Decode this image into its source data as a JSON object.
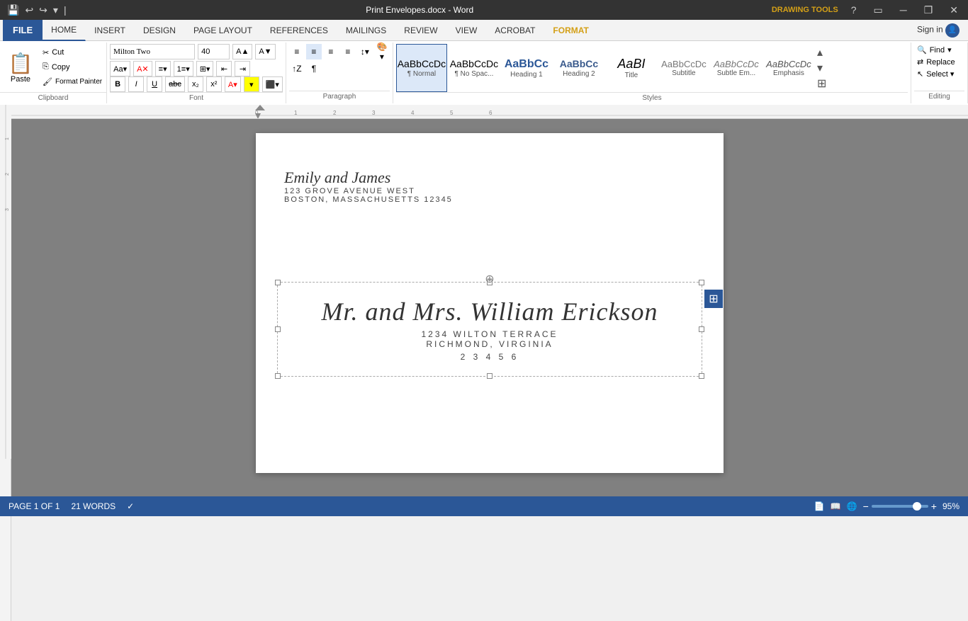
{
  "titleBar": {
    "title": "Print Envelopes.docx - Word",
    "drawingTools": "DRAWING TOOLS",
    "windowButtons": [
      "minimize",
      "restore",
      "close"
    ],
    "helpIcon": "?"
  },
  "tabs": {
    "file": "FILE",
    "home": "HOME",
    "insert": "INSERT",
    "design": "DESIGN",
    "pageLayout": "PAGE LAYOUT",
    "references": "REFERENCES",
    "mailings": "MAILINGS",
    "review": "REVIEW",
    "view": "VIEW",
    "acrobat": "ACROBAT",
    "format": "FORMAT",
    "signIn": "Sign in"
  },
  "clipboard": {
    "paste": "Paste",
    "cut": "Cut",
    "copy": "Copy",
    "formatPainter": "Format Painter",
    "groupLabel": "Clipboard"
  },
  "font": {
    "name": "Milton Two",
    "size": "40",
    "groupLabel": "Font",
    "bold": "B",
    "italic": "I",
    "underline": "U",
    "strikethrough": "abc",
    "subscript": "x₂",
    "superscript": "x²"
  },
  "paragraph": {
    "groupLabel": "Paragraph"
  },
  "styles": {
    "groupLabel": "Styles",
    "items": [
      {
        "id": "normal",
        "preview": "AaBbCcDc",
        "label": "¶ Normal",
        "active": true
      },
      {
        "id": "no-spacing",
        "preview": "AaBbCcDc",
        "label": "¶ No Spac...",
        "active": false
      },
      {
        "id": "heading1",
        "preview": "AaBbCc",
        "label": "Heading 1",
        "active": false
      },
      {
        "id": "heading2",
        "preview": "AaBbCc",
        "label": "Heading 2",
        "active": false
      },
      {
        "id": "title",
        "preview": "AaBI",
        "label": "Title",
        "active": false
      },
      {
        "id": "subtitle",
        "preview": "AaBbCcDc",
        "label": "Subtitle",
        "active": false
      },
      {
        "id": "subtle-em",
        "preview": "AaBbCcDc",
        "label": "Subtle Em...",
        "active": false
      },
      {
        "id": "emphasis",
        "preview": "AaBbCcDc",
        "label": "Emphasis",
        "active": false
      }
    ]
  },
  "editing": {
    "find": "Find",
    "replace": "Replace",
    "select": "Select ▾",
    "groupLabel": "Editing"
  },
  "document": {
    "returnAddress": {
      "name": "Emily and James",
      "street": "123 Grove Avenue West",
      "city": "Boston, Massachusetts 12345"
    },
    "recipientAddress": {
      "name": "Mr. and Mrs. William Erickson",
      "street": "1234 Wilton Terrace",
      "city": "Richmond, Virginia",
      "zip": "2  3  4  5  6"
    }
  },
  "statusBar": {
    "page": "PAGE 1 OF 1",
    "words": "21 WORDS",
    "zoom": "95%",
    "zoomMinus": "−",
    "zoomPlus": "+"
  }
}
